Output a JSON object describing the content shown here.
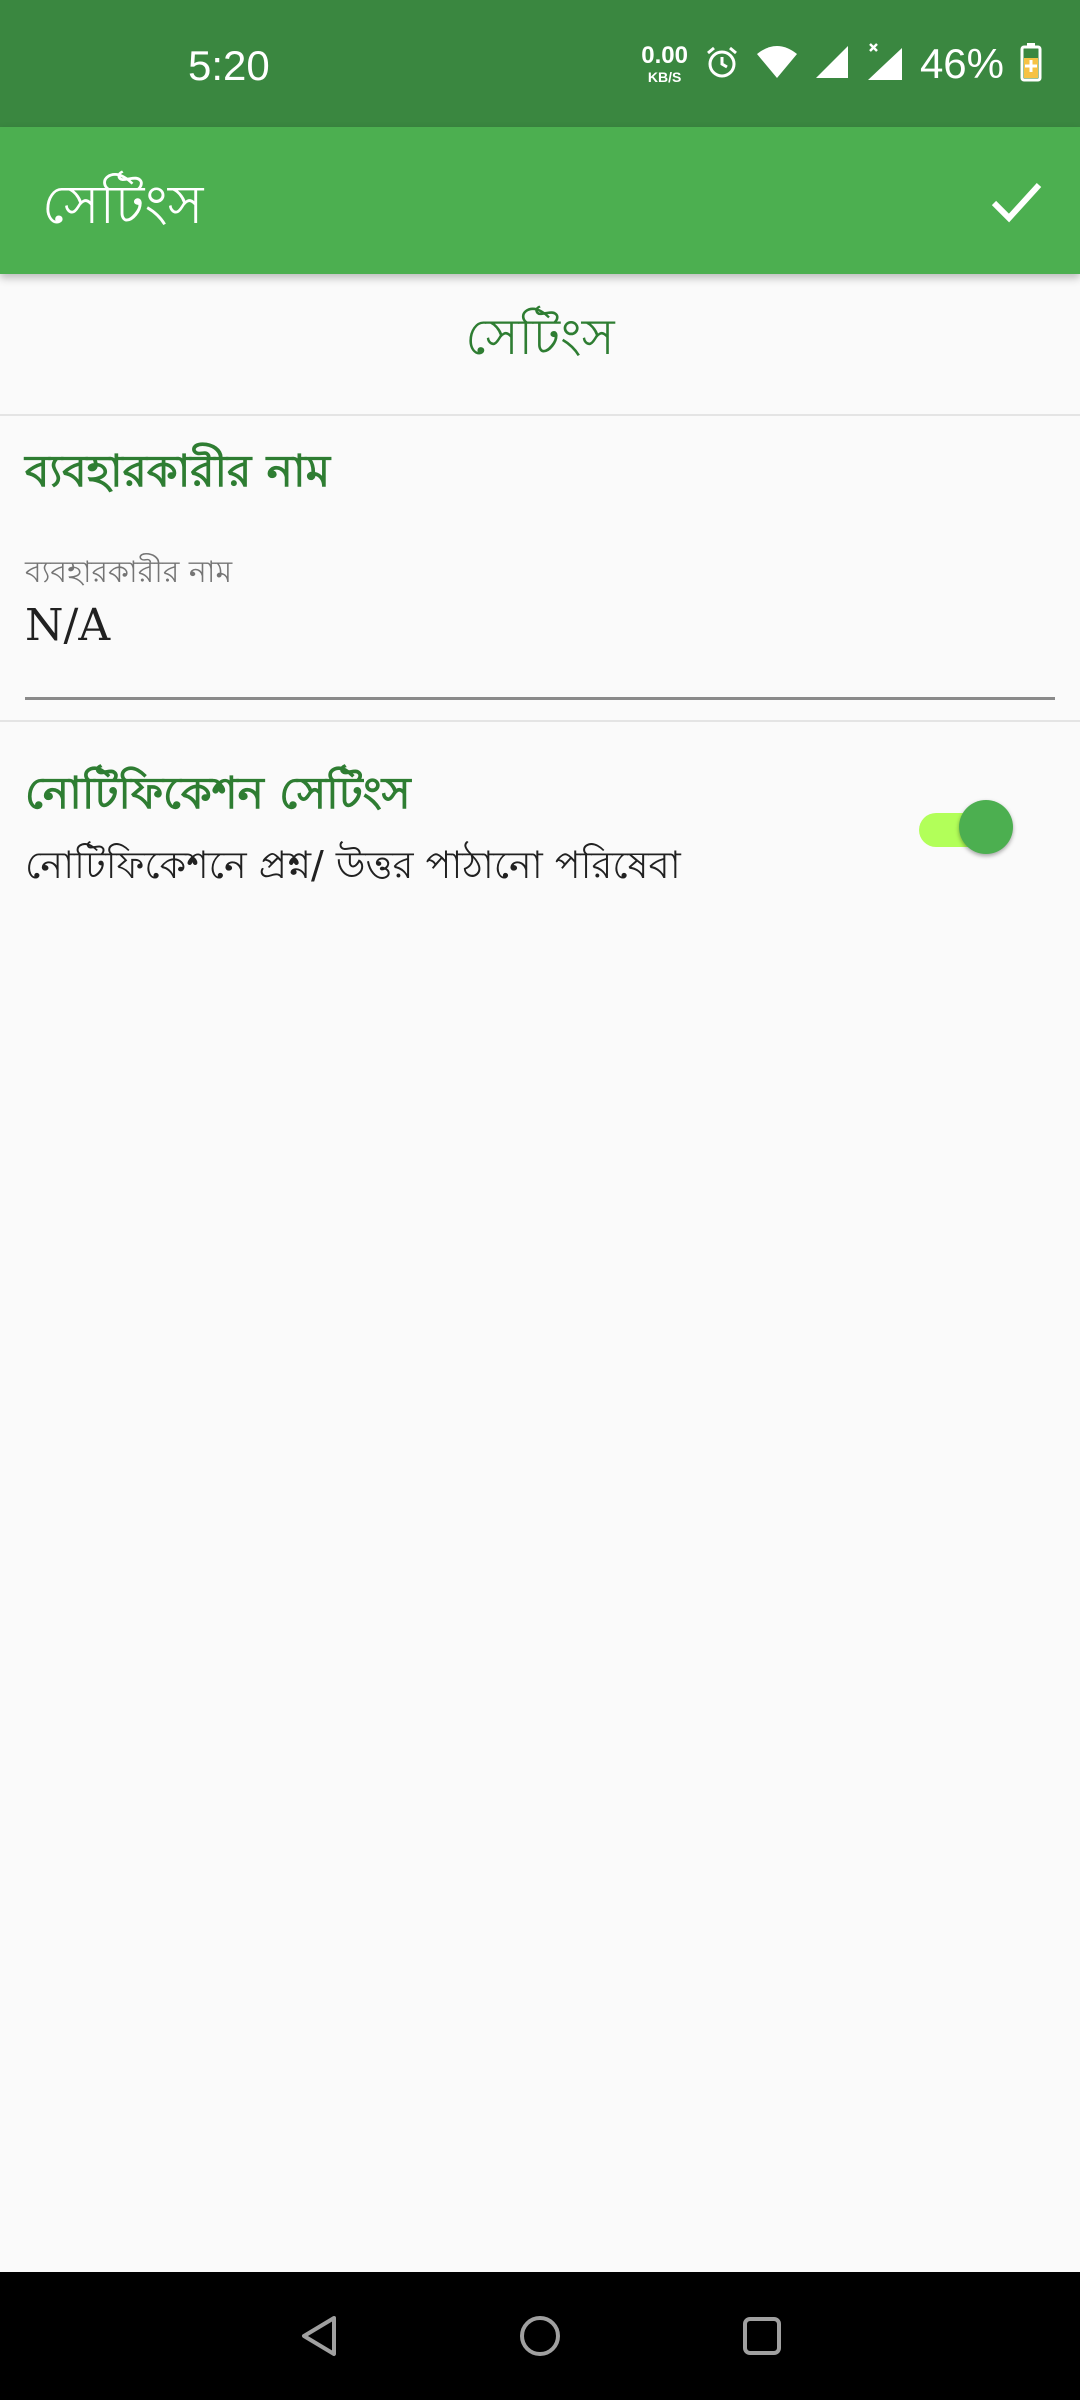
{
  "status_bar": {
    "time": "5:20",
    "net_speed": "0.00",
    "net_unit": "KB/S",
    "battery": "46%",
    "icons": [
      "alarm-icon",
      "wifi-icon",
      "signal-icon",
      "signal-x-icon",
      "battery-charging-icon"
    ]
  },
  "app_bar": {
    "title": "সেটিংস",
    "action_icon": "check-icon"
  },
  "page": {
    "heading": "সেটিংস"
  },
  "username_section": {
    "title": "ব্যবহারকারীর নাম",
    "field_label": "ব্যবহারকারীর নাম",
    "field_value": "N/A"
  },
  "notification_section": {
    "title": "নোটিফিকেশন সেটিংস",
    "summary": "নোটিফিকেশনে প্রশ্ন/ উত্তর পাঠানো পরিষেবা",
    "enabled": true
  },
  "colors": {
    "status_bar": "#3a8740",
    "app_bar": "#4caf50",
    "accent_text": "#2e7d32",
    "switch_track": "#b2ff59"
  },
  "nav_bar": {
    "icons": [
      "back-icon",
      "home-icon",
      "recents-icon"
    ]
  }
}
